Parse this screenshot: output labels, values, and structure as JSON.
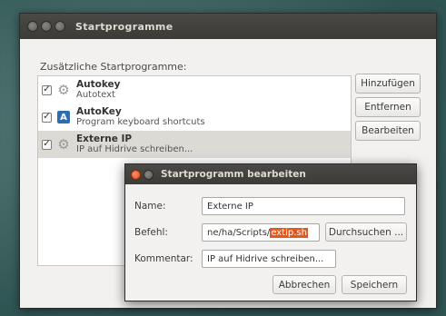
{
  "window": {
    "title": "Startprogramme"
  },
  "list": {
    "label": "Zusätzliche Startprogramme:",
    "items": [
      {
        "name": "Autokey",
        "description": "Autotext",
        "checked": true,
        "icon": "gears-icon"
      },
      {
        "name": "AutoKey",
        "description": "Program keyboard shortcuts",
        "checked": true,
        "icon": "autokey-a-icon"
      },
      {
        "name": "Externe IP",
        "description": "IP auf Hidrive schreiben...",
        "checked": true,
        "icon": "gears-icon"
      }
    ]
  },
  "buttons": {
    "add": "Hinzufügen",
    "remove": "Entfernen",
    "edit": "Bearbeiten"
  },
  "dialog": {
    "title": "Startprogramm bearbeiten",
    "name_label": "Name:",
    "name_value": "Externe IP",
    "command_label": "Befehl:",
    "command_prefix": "ne/ha/Scripts/",
    "command_selected": "extip.sh",
    "browse": "Durchsuchen ...",
    "comment_label": "Kommentar:",
    "comment_value": "IP auf Hidrive schreiben...",
    "cancel": "Abbrechen",
    "save": "Speichern"
  },
  "colors": {
    "selection": "#e4581e",
    "titlebar": "#3c3b37"
  }
}
